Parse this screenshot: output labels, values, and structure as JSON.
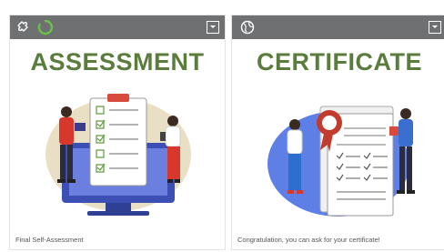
{
  "cards": [
    {
      "title": "ASSESSMENT",
      "caption": "Final Self-Assessment",
      "header_icons": [
        "puzzle-icon",
        "loading-spinner-icon"
      ],
      "collapse_icon": "chevron-down-icon"
    },
    {
      "title": "CERTIFICATE",
      "caption": "Congratulation, you can ask for your certificate!",
      "header_icons": [
        "globe-icon"
      ],
      "collapse_icon": "chevron-down-icon"
    }
  ],
  "colors": {
    "header_bg": "#6f7071",
    "title_green": "#5a7d3e",
    "spinner_green": "#6cc04a",
    "caption_text": "#555555"
  }
}
